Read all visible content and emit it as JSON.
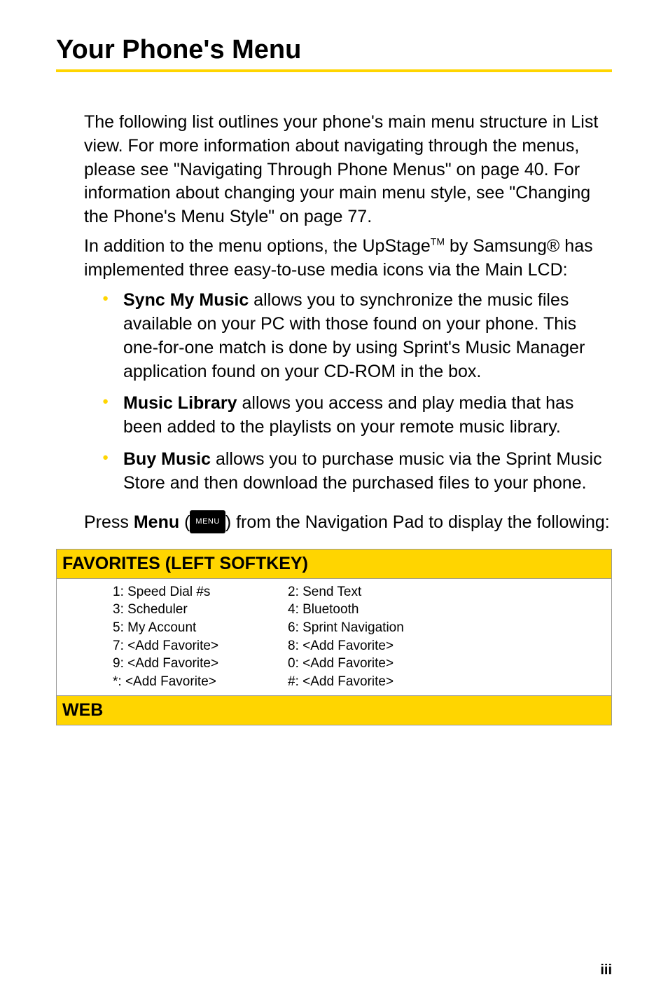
{
  "title": "Your Phone's Menu",
  "intro": {
    "p1": "The following list outlines your phone's main menu structure in List view. For more information about navigating through the menus, please see \"Navigating Through Phone Menus\" on page 40. For information about changing your main menu style, see \"Changing the Phone's Menu Style\" on page 77.",
    "p2a": "In addition to the menu options, the UpStage",
    "p2b": " by Samsung® has implemented three easy-to-use media icons via the Main LCD:"
  },
  "bullets": [
    {
      "label": "Sync My Music",
      "text": " allows you to synchronize the music files available on your PC with those found on your phone. This one-for-one match is done by using Sprint's Music Manager application found on your CD-ROM in the box."
    },
    {
      "label": "Music Library",
      "text": " allows you access and play media that has been added to the playlists on your remote music library."
    },
    {
      "label": "Buy Music",
      "text": " allows you to purchase music via the Sprint Music Store and then download the purchased files to your phone."
    }
  ],
  "press": {
    "a": "Press ",
    "menu": "Menu",
    "paren_open": " (",
    "btn": "MENU",
    "paren_close": ") from the Navigation Pad to display the following:"
  },
  "favorites": {
    "header": "FAVORITES (LEFT SOFTKEY)",
    "rows": [
      [
        "1: Speed Dial #s",
        "2: Send Text"
      ],
      [
        "3: Scheduler",
        "4: Bluetooth"
      ],
      [
        "5: My Account",
        "6: Sprint Navigation"
      ],
      [
        "7: <Add Favorite>",
        "8: <Add Favorite>"
      ],
      [
        "9: <Add Favorite>",
        "0: <Add Favorite>"
      ],
      [
        "*: <Add Favorite>",
        "#: <Add Favorite>"
      ]
    ]
  },
  "web": {
    "header": "WEB"
  },
  "pagenum": "iii"
}
